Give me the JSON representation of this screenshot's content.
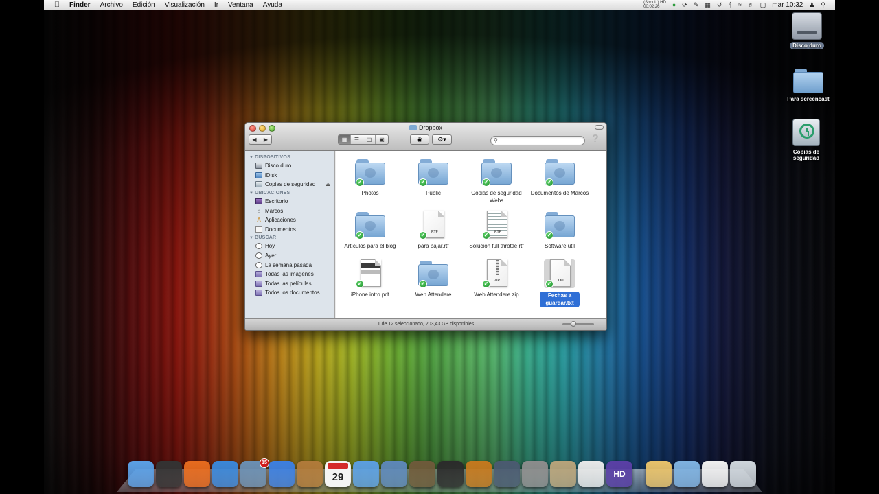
{
  "menubar": {
    "app_name": "Finder",
    "menus": [
      "Archivo",
      "Edición",
      "Visualización",
      "Ir",
      "Ventana",
      "Ayuda"
    ],
    "status": {
      "shou_label": "(ShouU) HD",
      "timer": "00:02:26",
      "clock": "mar 10:32"
    }
  },
  "desktop": {
    "icons": [
      {
        "label": "Disco duro",
        "icon": "hard-drive-icon"
      },
      {
        "label": "Para screencast",
        "icon": "folder-icon"
      },
      {
        "label": "Copias de seguridad",
        "icon": "time-machine-icon"
      }
    ]
  },
  "window": {
    "title": "Dropbox",
    "search_placeholder": "",
    "status_text": "1 de 12 seleccionado, 203,43 GB disponibles",
    "icon_size_fraction": 0.35,
    "sidebar": {
      "sections": [
        {
          "title": "DISPOSITIVOS",
          "items": [
            {
              "label": "Disco duro",
              "icon": "disk-icon"
            },
            {
              "label": "iDisk",
              "icon": "idisk-icon"
            },
            {
              "label": "Copias de seguridad",
              "icon": "time-machine-icon",
              "eject": "⏏"
            }
          ]
        },
        {
          "title": "UBICACIONES",
          "items": [
            {
              "label": "Escritorio",
              "icon": "desktop-icon"
            },
            {
              "label": "Marcos",
              "icon": "home-icon"
            },
            {
              "label": "Aplicaciones",
              "icon": "applications-icon"
            },
            {
              "label": "Documentos",
              "icon": "documents-icon"
            }
          ]
        },
        {
          "title": "BUSCAR",
          "items": [
            {
              "label": "Hoy",
              "icon": "clock-icon"
            },
            {
              "label": "Ayer",
              "icon": "clock-icon"
            },
            {
              "label": "La semana pasada",
              "icon": "clock-icon"
            },
            {
              "label": "Todas las imágenes",
              "icon": "smart-folder-icon"
            },
            {
              "label": "Todas las películas",
              "icon": "smart-folder-icon"
            },
            {
              "label": "Todos los documentos",
              "icon": "smart-folder-icon"
            }
          ]
        }
      ]
    },
    "files": [
      {
        "name": "Photos",
        "kind": "folder",
        "synced": true
      },
      {
        "name": "Public",
        "kind": "folder",
        "synced": true
      },
      {
        "name": "Copias de seguridad Webs",
        "kind": "folder",
        "synced": true
      },
      {
        "name": "Documentos de Marcos",
        "kind": "folder",
        "synced": true
      },
      {
        "name": "Artículos para el blog",
        "kind": "folder",
        "synced": true
      },
      {
        "name": "para bajar.rtf",
        "kind": "rtf",
        "ext": "RTF",
        "synced": true
      },
      {
        "name": "Solución full throttle.rtf",
        "kind": "rtf",
        "ext": "RTF",
        "synced": true
      },
      {
        "name": "Software útil",
        "kind": "folder",
        "synced": true
      },
      {
        "name": "iPhone intro.pdf",
        "kind": "pdf",
        "synced": true
      },
      {
        "name": "Web Attendere",
        "kind": "folder",
        "synced": true
      },
      {
        "name": "Web Attendere.zip",
        "kind": "zip",
        "ext": "ZIP",
        "synced": true
      },
      {
        "name": "Fechas a guardar.txt",
        "kind": "txt",
        "ext": "TXT",
        "synced": true,
        "selected": true
      }
    ]
  },
  "dock": {
    "apps": [
      {
        "name": "finder",
        "icon": "finder-icon",
        "color": "#5aa0e6"
      },
      {
        "name": "dashboard",
        "icon": "dashboard-icon",
        "color": "#333333"
      },
      {
        "name": "firefox",
        "icon": "firefox-icon",
        "color": "#e66b1e"
      },
      {
        "name": "safari",
        "icon": "safari-icon",
        "color": "#3a87d9"
      },
      {
        "name": "mail",
        "icon": "mail-icon",
        "color": "#6a8fb3",
        "badge": "15"
      },
      {
        "name": "ichat",
        "icon": "ichat-icon",
        "color": "#3c7fe0"
      },
      {
        "name": "address-book",
        "icon": "address-book-icon",
        "color": "#b07a3a"
      },
      {
        "name": "ical",
        "icon": "ical-icon",
        "color": "#f2f2f2",
        "day": "29"
      },
      {
        "name": "itunes",
        "icon": "itunes-icon",
        "color": "#5b9ee0"
      },
      {
        "name": "iphoto",
        "icon": "iphoto-icon",
        "color": "#5d87b8"
      },
      {
        "name": "image-capture",
        "icon": "image-capture-icon",
        "color": "#6e5a3a"
      },
      {
        "name": "imovie",
        "icon": "imovie-icon",
        "color": "#2b2b2b"
      },
      {
        "name": "garageband",
        "icon": "garageband-icon",
        "color": "#c4781e"
      },
      {
        "name": "spaces",
        "icon": "spaces-icon",
        "color": "#4a5a70"
      },
      {
        "name": "system-preferences",
        "icon": "system-preferences-icon",
        "color": "#8c8c8c"
      },
      {
        "name": "preview",
        "icon": "preview-icon",
        "color": "#b8a37a"
      },
      {
        "name": "textedit",
        "icon": "textedit-icon",
        "color": "#e8e8e8"
      },
      {
        "name": "hd-app",
        "icon": "hd-app-icon",
        "color": "#5a3fa5",
        "label": "HD"
      }
    ],
    "stacks": [
      {
        "name": "documents-stack",
        "icon": "folder-stack-icon",
        "color": "#e8c26a"
      },
      {
        "name": "applications-stack",
        "icon": "applications-stack-icon",
        "color": "#7fb2e0"
      },
      {
        "name": "home-stack",
        "icon": "home-stack-icon",
        "color": "#f0f0f0"
      },
      {
        "name": "trash",
        "icon": "trash-icon",
        "color": "#cfd6dc"
      }
    ]
  }
}
